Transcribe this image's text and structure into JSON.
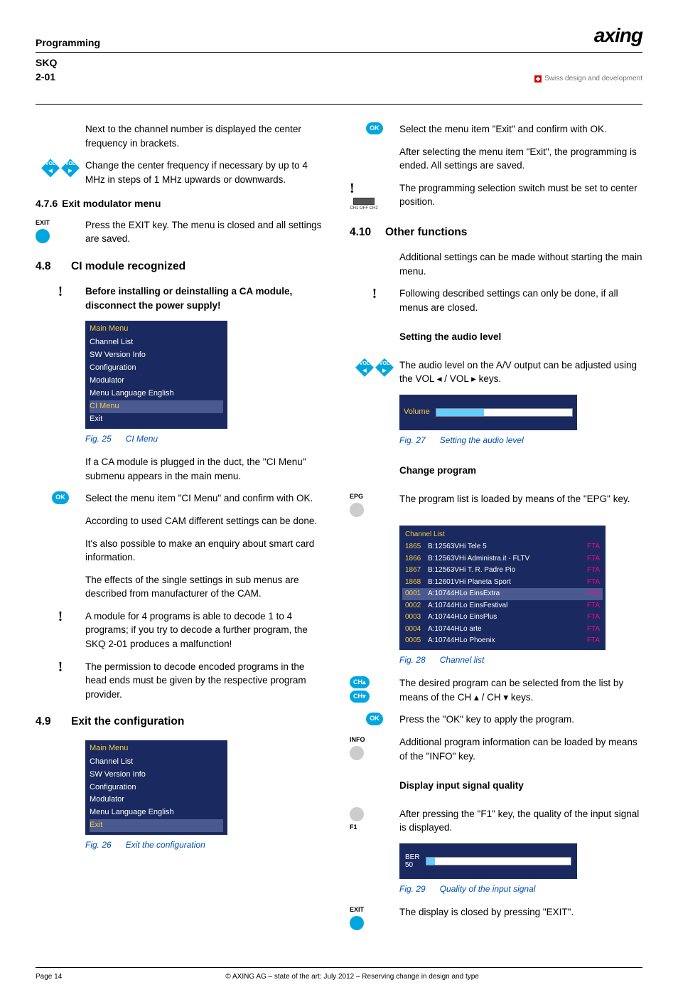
{
  "header": {
    "section": "Programming",
    "model": "SKQ 2-01",
    "logo": "axing",
    "tagline": "Swiss design and development"
  },
  "left": {
    "p1": "Next to the channel number is displayed the center frequency in brackets.",
    "p2": "Change the center frequency if necessary by up to 4 MHz in steps of 1 MHz upwards or downwards.",
    "s476_num": "4.7.6",
    "s476_title": "Exit modulator menu",
    "p3": "Press the EXIT key. The menu is closed and all settings are saved.",
    "s48_num": "4.8",
    "s48_title": "CI module recognized",
    "p4": "Before installing or deinstalling a CA module, disconnect the power supply!",
    "menu1": {
      "title": "Main Menu",
      "items": [
        "Channel List",
        "SW Version Info",
        "Configuration",
        "Modulator",
        "Menu Language    English",
        "CI Menu",
        "Exit"
      ]
    },
    "fig25_num": "Fig. 25",
    "fig25_cap": "CI Menu",
    "p5": "If a CA module is plugged in the duct, the \"CI Menu\" submenu appears in the main menu.",
    "p6": "Select the menu item \"CI Menu\" and confirm with OK.",
    "p7": "According to used CAM different settings can be done.",
    "p8": "It's also possible to make an enquiry about smart card information.",
    "p9": "The effects of the single settings in sub menus are described from manufacturer of the CAM.",
    "p10": "A module for 4 programs is able to decode 1 to 4 programs; if you try to decode a further program, the SKQ 2-01 produces a malfunction!",
    "p11": "The permission to decode encoded programs in the head ends must be given by the respective program provider.",
    "s49_num": "4.9",
    "s49_title": "Exit the configuration",
    "menu2": {
      "title": "Main Menu",
      "items": [
        "Channel List",
        "SW Version Info",
        "Configuration",
        "Modulator",
        "Menu Language    English",
        "Exit"
      ]
    },
    "fig26_num": "Fig. 26",
    "fig26_cap": "Exit the configuration"
  },
  "right": {
    "p1": "Select the menu item \"Exit\" and confirm with OK.",
    "p2": "After selecting the menu item \"Exit\", the programming is ended. All settings are saved.",
    "p3": "The programming selection switch must be set to center position.",
    "switch_label": "CH1  OFF  CH2",
    "s410_num": "4.10",
    "s410_title": "Other functions",
    "p4": "Additional settings can be made without starting the main menu.",
    "p5": "Following described settings can only be done, if all menus are closed.",
    "h_audio": "Setting the audio level",
    "p6": "The audio level on the A/V output can be adjusted using the VOL ◂ / VOL ▸ keys.",
    "vol_label": "Volume",
    "fig27_num": "Fig. 27",
    "fig27_cap": "Setting the audio level",
    "h_change": "Change program",
    "p7": "The program list is loaded by means of the \"EPG\" key.",
    "chan_title": "Channel List",
    "channels": [
      {
        "n": "1865",
        "f": "B:12563VHi Tele 5",
        "t": "FTA"
      },
      {
        "n": "1866",
        "f": "B:12563VHi Administra.it - FLTV",
        "t": "FTA"
      },
      {
        "n": "1867",
        "f": "B:12563VHi T. R. Padre Pio",
        "t": "FTA"
      },
      {
        "n": "1868",
        "f": "B:12601VHi Planeta Sport",
        "t": "FTA"
      },
      {
        "n": "0001",
        "f": "A:10744HLo EinsExtra",
        "t": "FTA",
        "sel": true
      },
      {
        "n": "0002",
        "f": "A:10744HLo EinsFestival",
        "t": "FTA"
      },
      {
        "n": "0003",
        "f": "A:10744HLo EinsPlus",
        "t": "FTA"
      },
      {
        "n": "0004",
        "f": "A:10744HLo arte",
        "t": "FTA"
      },
      {
        "n": "0005",
        "f": "A:10744HLo Phoenix",
        "t": "FTA"
      }
    ],
    "fig28_num": "Fig. 28",
    "fig28_cap": "Channel list",
    "p8": "The desired program can be selected from the list by means of the CH ▴ / CH ▾ keys.",
    "p9": "Press the \"OK\" key to apply the program.",
    "p10": "Additional program information can be loaded by means of the \"INFO\" key.",
    "h_quality": "Display input signal quality",
    "p11": "After pressing the \"F1\" key, the quality of the input signal is displayed.",
    "ber_label1": "BER",
    "ber_label2": "50",
    "fig29_num": "Fig. 29",
    "fig29_cap": "Quality of the input signal",
    "p12": "The display is closed by pressing \"EXIT\"."
  },
  "icons": {
    "vol": "VOL",
    "ok": "OK",
    "exit": "EXIT",
    "epg": "EPG",
    "info": "INFO",
    "f1": "F1",
    "ch_up": "CH▴",
    "ch_dn": "CH▾"
  },
  "footer": {
    "page": "Page 14",
    "copy": "© AXING AG – state of the art: July 2012 – Reserving change in design and type"
  }
}
